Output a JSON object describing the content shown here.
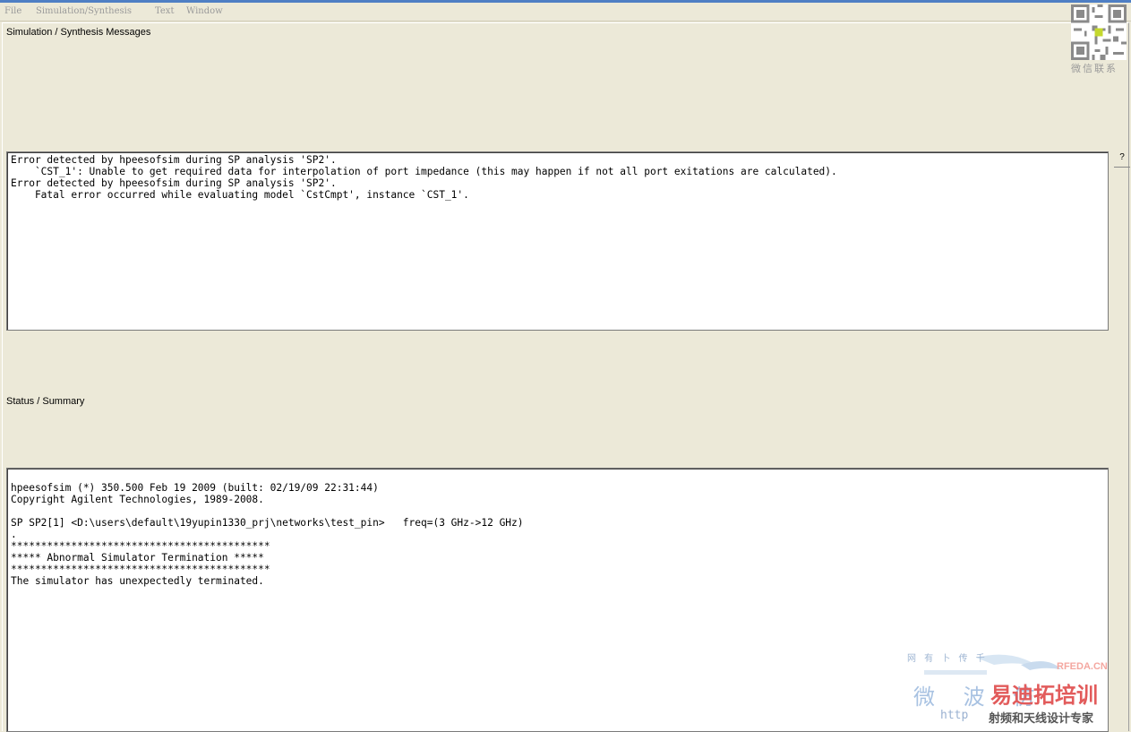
{
  "menubar": {
    "items": [
      "File",
      "Simulation/Synthesis",
      "Text",
      "Window"
    ]
  },
  "messages": {
    "label": "Simulation / Synthesis Messages",
    "lines": [
      "Error detected by hpeesofsim during SP analysis 'SP2'.",
      "    `CST_1': Unable to get required data for interpolation of port impedance (this may happen if not all port exitations are calculated).",
      "Error detected by hpeesofsim during SP analysis 'SP2'.",
      "    Fatal error occurred while evaluating model `CstCmpt', instance `CST_1'."
    ]
  },
  "help": {
    "label": "?"
  },
  "status": {
    "label": "Status / Summary",
    "lines": [
      "",
      "hpeesofsim (*) 350.500 Feb 19 2009 (built: 02/19/09 22:31:44)",
      "Copyright Agilent Technologies, 1989-2008.",
      "",
      "SP SP2[1] <D:\\users\\default\\19yupin1330_prj\\networks\\test_pin>   freq=(3 GHz->12 GHz)",
      ".",
      "*******************************************",
      "***** Abnormal Simulator Termination *****",
      "*******************************************",
      "The simulator has unexpectedly terminated."
    ]
  },
  "qr": {
    "caption": "微信联系"
  },
  "watermark": {
    "sub": "网 有 卜 传 千",
    "rfeda": "RFEDA.CN",
    "main1": "微 波 仿",
    "main2": "易迪拓培训",
    "url": "http",
    "tagline": "射频和天线设计专家"
  }
}
